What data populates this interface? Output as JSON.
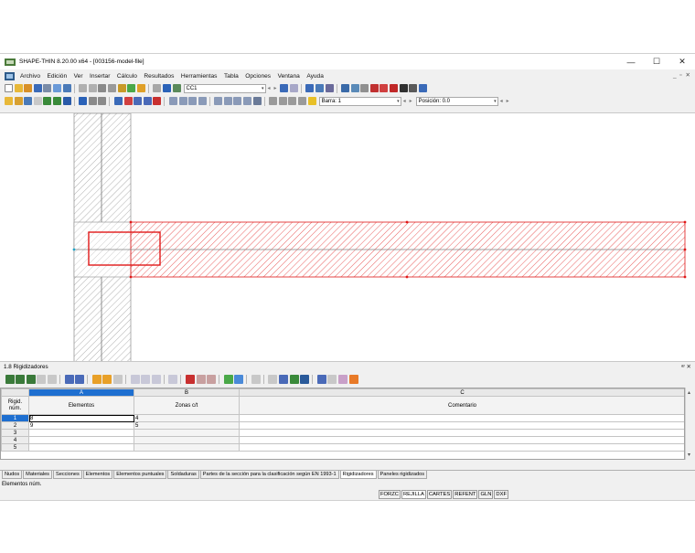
{
  "window": {
    "title": "SHAPE-THIN 8.20.00 x64 - [003156-model-file]",
    "controls": [
      "—",
      "☐",
      "✕"
    ]
  },
  "menubar": {
    "items": [
      "Archivo",
      "Edición",
      "Ver",
      "Insertar",
      "Cálculo",
      "Resultados",
      "Herramientas",
      "Tabla",
      "Opciones",
      "Ventana",
      "Ayuda"
    ],
    "mdi_controls": "_ ▫ ✕"
  },
  "toolbar1": {
    "load_case": "CC1"
  },
  "toolbar2": {
    "member_combo": "Barra: 1",
    "position_label": "Posición: 0.0"
  },
  "colors": {
    "accent": "#1e6fd0",
    "section_red": "#e01818",
    "hatch_gray": "#8c8c8c"
  },
  "panel": {
    "title": "1.8 Rigidizadores",
    "controls": "ᵆ ✕"
  },
  "grid": {
    "columns": [
      "A",
      "B",
      "C"
    ],
    "row_header_title": "Rigid. núm.",
    "headers": [
      "Elementos",
      "Zonas c/t",
      "Comentario"
    ],
    "rows": [
      {
        "num": "1",
        "a": "8",
        "b": "4",
        "c": ""
      },
      {
        "num": "2",
        "a": "9",
        "b": "5",
        "c": ""
      },
      {
        "num": "3",
        "a": "",
        "b": "",
        "c": ""
      },
      {
        "num": "4",
        "a": "",
        "b": "",
        "c": ""
      },
      {
        "num": "5",
        "a": "",
        "b": "",
        "c": ""
      }
    ]
  },
  "tabs": [
    "Nudos",
    "Materiales",
    "Secciones",
    "Elementos",
    "Elementos puntuales",
    "Soldaduras",
    "Partes de la sección para la clasificación según EN 1993-1",
    "Rigidizadores",
    "Paneles rigidizados"
  ],
  "active_tab": "Rigidizadores",
  "status": {
    "text": "Elementos núm.",
    "buttons": [
      "FORZC",
      "REJILLA",
      "CARTES",
      "REFENT",
      "GLN",
      "DXF"
    ]
  }
}
